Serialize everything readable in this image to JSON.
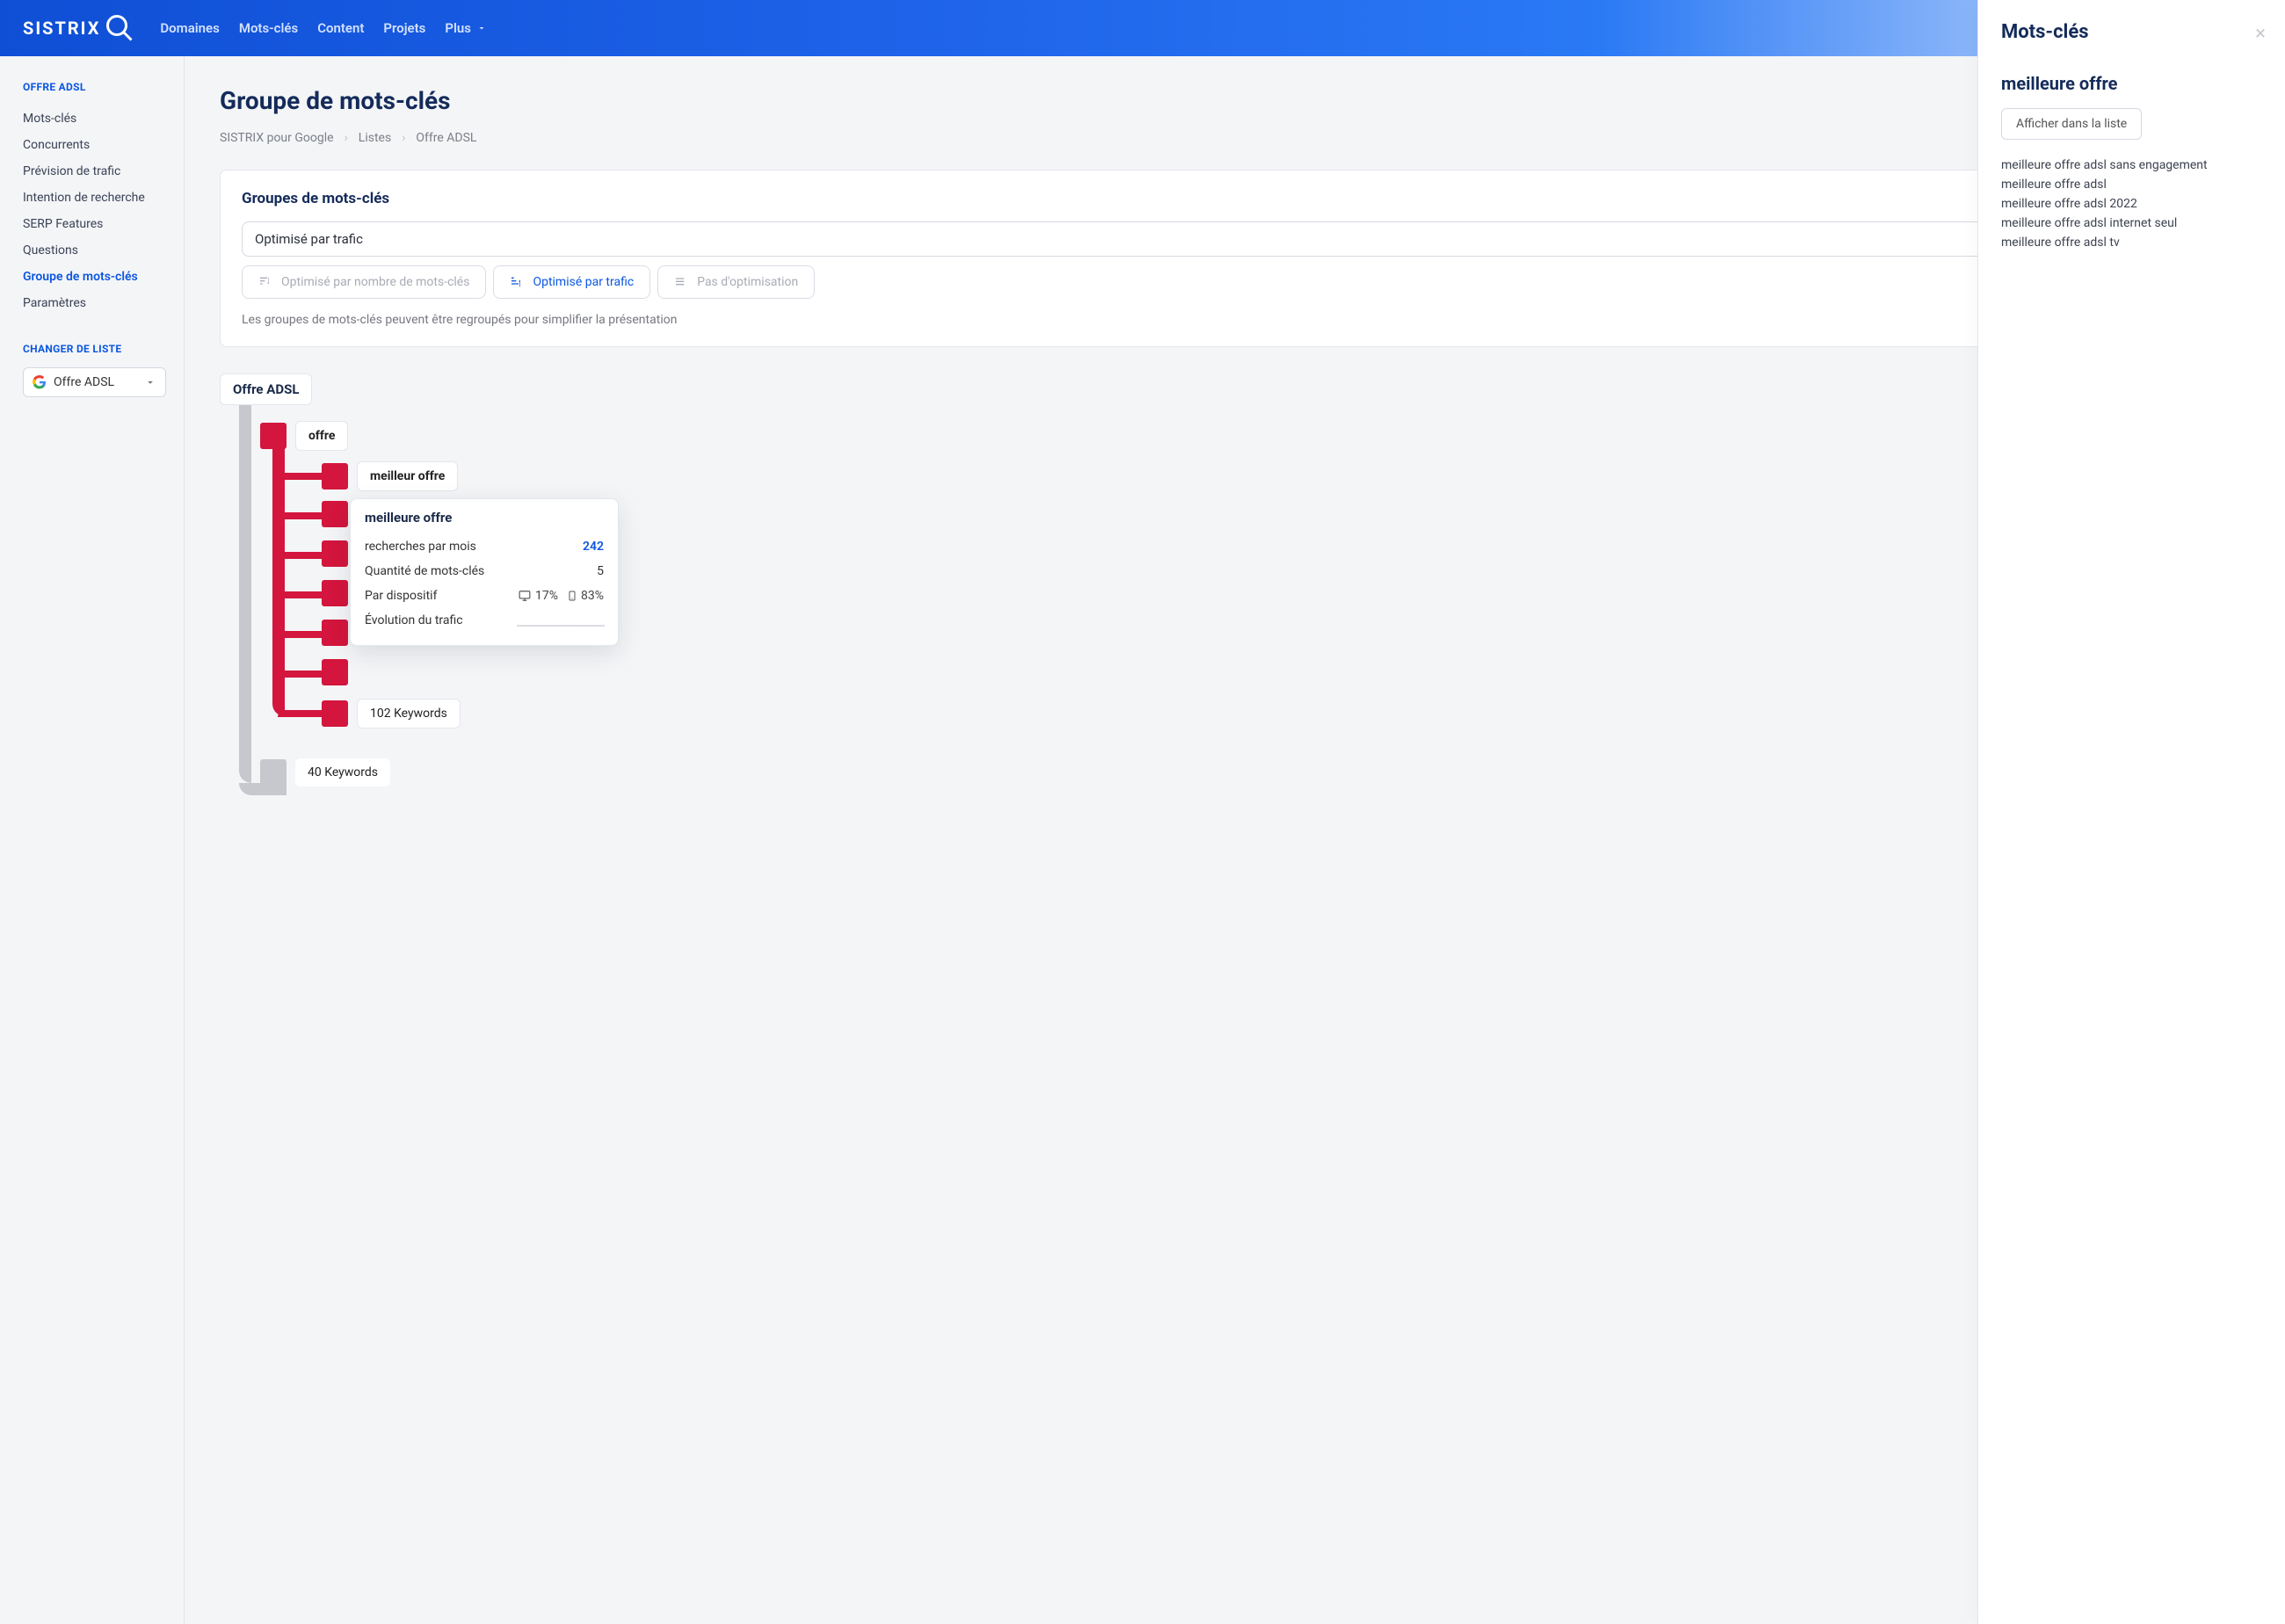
{
  "brand": "SISTRIX",
  "nav": [
    "Domaines",
    "Mots-clés",
    "Content",
    "Projets",
    "Plus"
  ],
  "sidebar": {
    "section1_title": "OFFRE ADSL",
    "items": [
      "Mots-clés",
      "Concurrents",
      "Prévision de trafic",
      "Intention de recherche",
      "SERP Features",
      "Questions",
      "Groupe de mots-clés",
      "Paramètres"
    ],
    "active_index": 6,
    "section2_title": "CHANGER DE LISTE",
    "list_selected": "Offre ADSL"
  },
  "page": {
    "title": "Groupe de mots-clés",
    "breadcrumb": [
      "SISTRIX pour Google",
      "Listes",
      "Offre ADSL"
    ]
  },
  "panel": {
    "title": "Groupes de mots-clés",
    "select_value": "Optimisé par trafic",
    "segments": [
      "Optimisé par nombre de mots-clés",
      "Optimisé par trafic",
      "Pas d'optimisation"
    ],
    "active_segment": 1,
    "note": "Les groupes de mots-clés peuvent être regroupés pour simplifier la présentation"
  },
  "tree": {
    "root": "Offre ADSL",
    "offre": "offre",
    "leaves": [
      "meilleur offre",
      "meilleure offre"
    ],
    "more_keywords": "102 Keywords",
    "bottom_keywords": "40 Keywords"
  },
  "tooltip": {
    "title": "meilleure offre",
    "rows": {
      "searches_label": "recherches par mois",
      "searches_value": "242",
      "qty_label": "Quantité de mots-clés",
      "qty_value": "5",
      "device_label": "Par dispositif",
      "device_desktop": "17%",
      "device_mobile": "83%",
      "evolution_label": "Évolution du trafic"
    }
  },
  "right": {
    "heading": "Mots-clés",
    "subheading": "meilleure offre",
    "button": "Afficher dans la liste",
    "items": [
      "meilleure offre adsl sans engagement",
      "meilleure offre adsl",
      "meilleure offre adsl 2022",
      "meilleure offre adsl internet seul",
      "meilleure offre adsl tv"
    ]
  }
}
